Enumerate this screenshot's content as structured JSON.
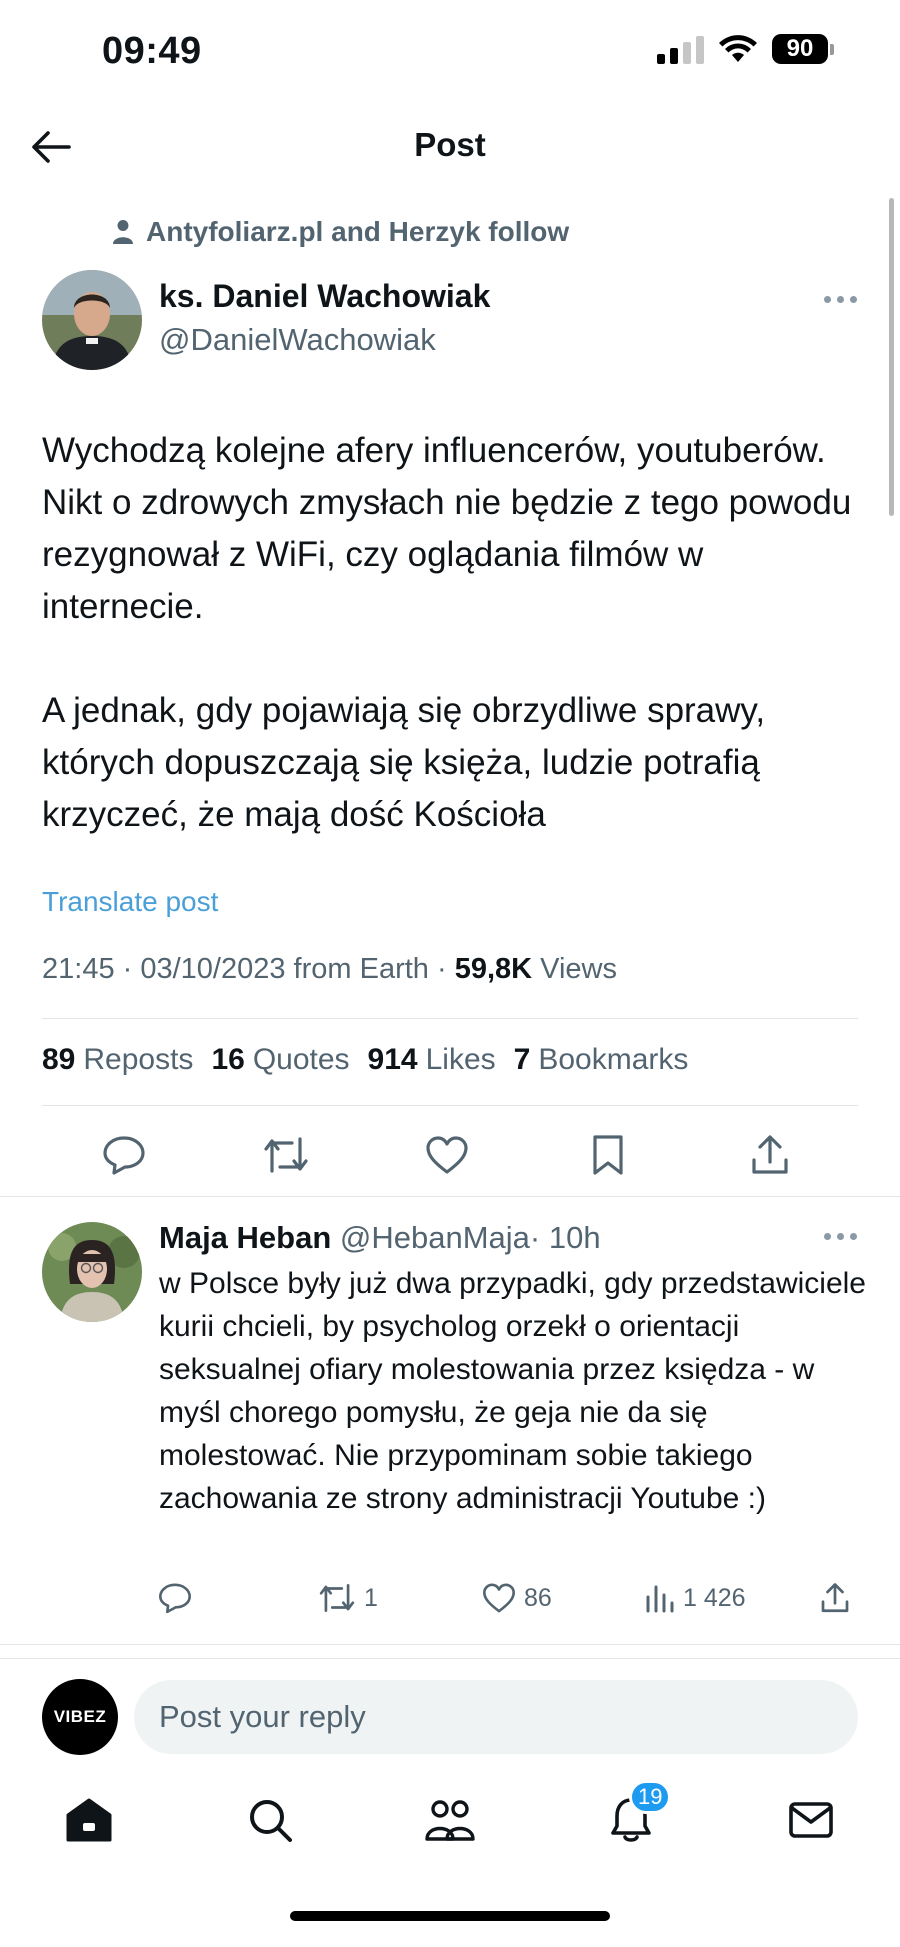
{
  "status_bar": {
    "time": "09:49",
    "battery": "90"
  },
  "header": {
    "title": "Post"
  },
  "social_context": "Antyfoliarz.pl and Herzyk follow",
  "post": {
    "author_name": "ks. Daniel Wachowiak",
    "author_handle": "@DanielWachowiak",
    "paragraph1": "Wychodzą kolejne afery influencerów, youtuberów. Nikt o zdrowych zmysłach nie będzie z tego powodu rezygnował z WiFi, czy oglądania filmów w internecie.",
    "paragraph2": "A jednak, gdy pojawiają się obrzydliwe sprawy, których dopuszczają się księża, ludzie potrafią krzyczeć, że mają dość Kościoła",
    "translate_label": "Translate post",
    "meta_text": "21:45 · 03/10/2023 from Earth · ",
    "views_count": "59,8K",
    "views_label": "Views",
    "stats": [
      {
        "count": "89",
        "label": "Reposts"
      },
      {
        "count": "16",
        "label": "Quotes"
      },
      {
        "count": "914",
        "label": "Likes"
      },
      {
        "count": "7",
        "label": "Bookmarks"
      }
    ]
  },
  "reply": {
    "name": "Maja Heban",
    "handle": "@HebanMaja",
    "time": "· 10h",
    "text": "w Polsce były już dwa przypadki, gdy przedstawiciele kurii chcieli, by psycholog orzekł o orientacji seksualnej ofiary molestowania przez księdza - w myśl chorego pomysłu, że geja nie da się molestować. Nie przypominam sobie takiego zachowania ze strony administracji Youtube :)",
    "reposts": "1",
    "likes": "86",
    "views": "1 426"
  },
  "composer": {
    "avatar_label": "VIBEZ",
    "placeholder": "Post your reply"
  },
  "tabbar": {
    "notifications_badge": "19"
  },
  "colors": {
    "accent": "#1d9bf0",
    "secondary_text": "#536471",
    "link": "#4a9fd8"
  }
}
